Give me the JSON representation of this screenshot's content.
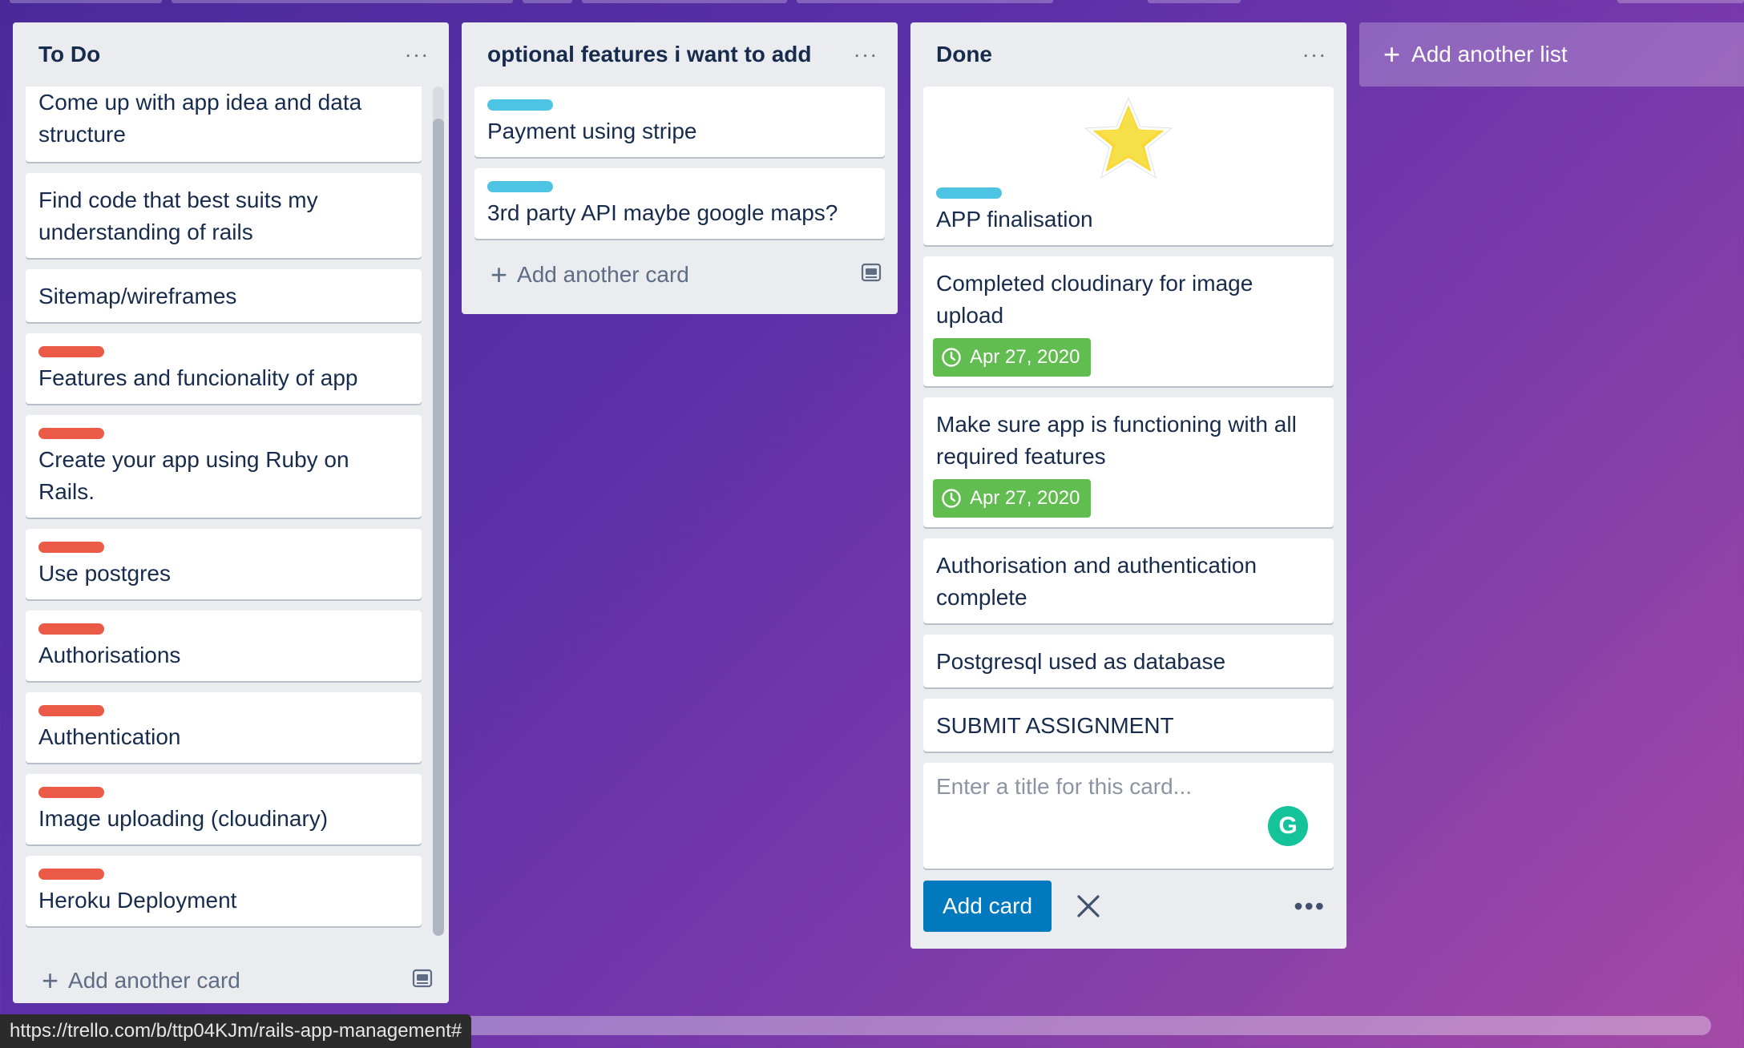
{
  "lists": [
    {
      "title": "To Do",
      "cards": [
        {
          "text": "Come up with app idea and data structure"
        },
        {
          "text": "Find code that best suits my understanding of rails"
        },
        {
          "text": "Sitemap/wireframes"
        },
        {
          "text": "Features and funcionality of app",
          "label": "red"
        },
        {
          "text": "Create your app using Ruby on Rails.",
          "label": "red"
        },
        {
          "text": "Use postgres",
          "label": "red"
        },
        {
          "text": "Authorisations",
          "label": "red"
        },
        {
          "text": "Authentication",
          "label": "red"
        },
        {
          "text": "Image uploading (cloudinary)",
          "label": "red"
        },
        {
          "text": "Heroku Deployment",
          "label": "red"
        }
      ],
      "add_card_label": "Add another card"
    },
    {
      "title": "optional features i want to add",
      "cards": [
        {
          "text": "Payment using stripe",
          "label": "blue"
        },
        {
          "text": "3rd party API maybe google maps?",
          "label": "blue"
        }
      ],
      "add_card_label": "Add another card"
    },
    {
      "title": "Done",
      "cards": [
        {
          "text": "APP finalisation",
          "label": "blue",
          "sticker": "star"
        },
        {
          "text": "Completed cloudinary for image upload",
          "due": "Apr 27, 2020"
        },
        {
          "text": "Make sure app is functioning with all required features",
          "due": "Apr 27, 2020"
        },
        {
          "text": "Authorisation and authentication complete"
        },
        {
          "text": "Postgresql used as database"
        },
        {
          "text": "SUBMIT ASSIGNMENT"
        }
      ],
      "composer": {
        "placeholder": "Enter a title for this card...",
        "add_button": "Add card"
      }
    }
  ],
  "add_list_label": "Add another list",
  "status_url": "https://trello.com/b/ttp04KJm/rails-app-management#",
  "colors": {
    "label_red": "#eb5a46",
    "label_blue": "#4dc4e3",
    "due_complete": "#61bd4f",
    "primary_button": "#0079bf"
  }
}
